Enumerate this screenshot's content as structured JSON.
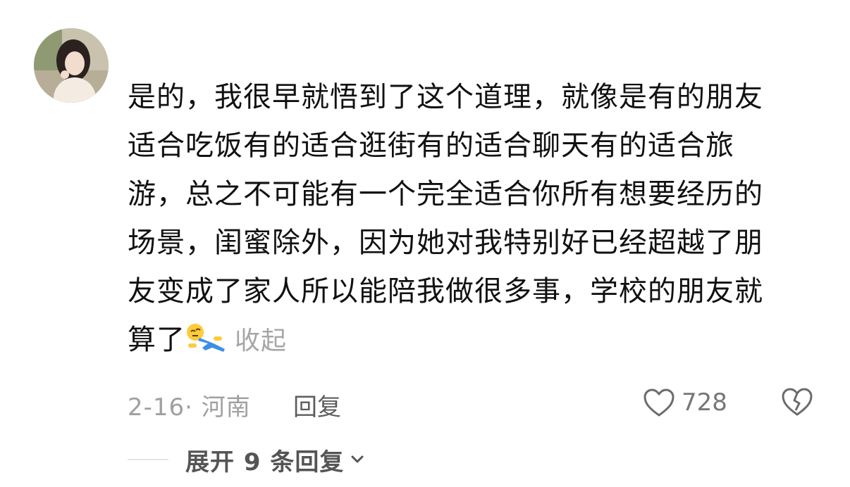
{
  "comment": {
    "lines": [
      "是的，我很早就悟到了这个道理，就像是有的朋友",
      "适合吃饭有的适合逛街有的适合聊天有的适合旅",
      "游，总之不可能有一个完全适合你所有想要经历的",
      "场景，闺蜜除外，因为她对我特别好已经超越了朋",
      "友变成了家人所以能陪我做很多事，学校的朋友就",
      "算了"
    ],
    "emoji": "lying-down-emoji",
    "collapse_label": "收起"
  },
  "meta": {
    "date_location": "2-16· 河南",
    "reply_label": "回复",
    "like_count": "728"
  },
  "replies": {
    "expand_label": "展开 9 条回复"
  },
  "icons": {
    "like": "heart-outline-icon",
    "dislike": "broken-heart-icon",
    "expand": "chevron-down-icon"
  },
  "colors": {
    "text": "#111111",
    "muted": "#a0a0a0",
    "icon": "#6b6b6b"
  }
}
